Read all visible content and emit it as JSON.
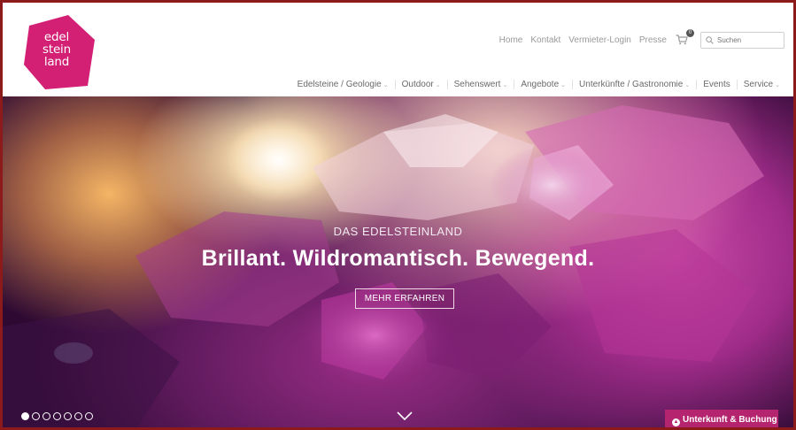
{
  "logo": {
    "lines": [
      "edel",
      "stein",
      "land"
    ]
  },
  "top_links": [
    {
      "label": "Home"
    },
    {
      "label": "Kontakt"
    },
    {
      "label": "Vermieter-Login"
    },
    {
      "label": "Presse"
    }
  ],
  "cart": {
    "icon": "cart-icon",
    "count": "0"
  },
  "search": {
    "placeholder": "Suchen",
    "icon": "search-icon"
  },
  "main_nav": [
    {
      "label": "Edelsteine / Geologie",
      "has_dropdown": true
    },
    {
      "label": "Outdoor",
      "has_dropdown": true
    },
    {
      "label": "Sehenswert",
      "has_dropdown": true
    },
    {
      "label": "Angebote",
      "has_dropdown": true
    },
    {
      "label": "Unterkünfte / Gastronomie",
      "has_dropdown": true
    },
    {
      "label": "Events",
      "has_dropdown": false
    },
    {
      "label": "Service",
      "has_dropdown": true
    }
  ],
  "hero": {
    "kicker": "DAS EDELSTEINLAND",
    "headline": "Brillant. Wildromantisch. Bewegend.",
    "cta_label": "MEHR ERFAHREN",
    "slides_total": 7,
    "active_slide": 1
  },
  "booking": {
    "label": "Unterkunft & Buchung"
  },
  "colors": {
    "brand_pink": "#d31f74",
    "booking_bg": "#b5256f",
    "border": "#8c1a1a"
  }
}
